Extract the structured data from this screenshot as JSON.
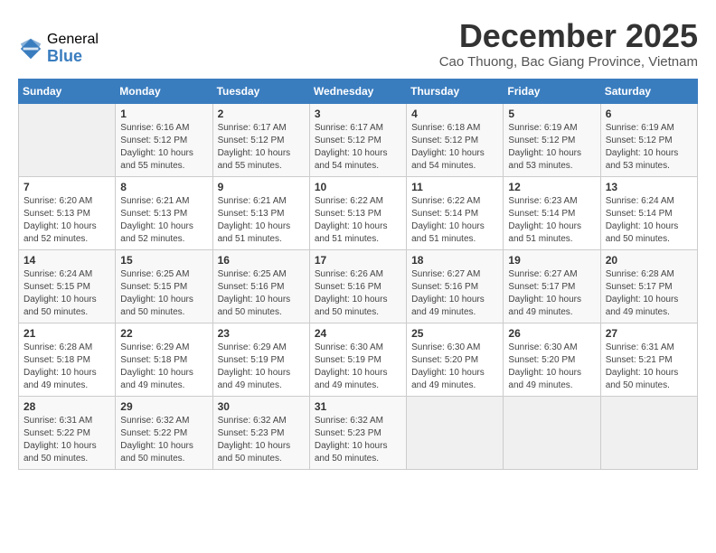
{
  "logo": {
    "general": "General",
    "blue": "Blue"
  },
  "header": {
    "month": "December 2025",
    "location": "Cao Thuong, Bac Giang Province, Vietnam"
  },
  "weekdays": [
    "Sunday",
    "Monday",
    "Tuesday",
    "Wednesday",
    "Thursday",
    "Friday",
    "Saturday"
  ],
  "weeks": [
    [
      {
        "day": "",
        "sunrise": "",
        "sunset": "",
        "daylight": ""
      },
      {
        "day": "1",
        "sunrise": "Sunrise: 6:16 AM",
        "sunset": "Sunset: 5:12 PM",
        "daylight": "Daylight: 10 hours and 55 minutes."
      },
      {
        "day": "2",
        "sunrise": "Sunrise: 6:17 AM",
        "sunset": "Sunset: 5:12 PM",
        "daylight": "Daylight: 10 hours and 55 minutes."
      },
      {
        "day": "3",
        "sunrise": "Sunrise: 6:17 AM",
        "sunset": "Sunset: 5:12 PM",
        "daylight": "Daylight: 10 hours and 54 minutes."
      },
      {
        "day": "4",
        "sunrise": "Sunrise: 6:18 AM",
        "sunset": "Sunset: 5:12 PM",
        "daylight": "Daylight: 10 hours and 54 minutes."
      },
      {
        "day": "5",
        "sunrise": "Sunrise: 6:19 AM",
        "sunset": "Sunset: 5:12 PM",
        "daylight": "Daylight: 10 hours and 53 minutes."
      },
      {
        "day": "6",
        "sunrise": "Sunrise: 6:19 AM",
        "sunset": "Sunset: 5:12 PM",
        "daylight": "Daylight: 10 hours and 53 minutes."
      }
    ],
    [
      {
        "day": "7",
        "sunrise": "Sunrise: 6:20 AM",
        "sunset": "Sunset: 5:13 PM",
        "daylight": "Daylight: 10 hours and 52 minutes."
      },
      {
        "day": "8",
        "sunrise": "Sunrise: 6:21 AM",
        "sunset": "Sunset: 5:13 PM",
        "daylight": "Daylight: 10 hours and 52 minutes."
      },
      {
        "day": "9",
        "sunrise": "Sunrise: 6:21 AM",
        "sunset": "Sunset: 5:13 PM",
        "daylight": "Daylight: 10 hours and 51 minutes."
      },
      {
        "day": "10",
        "sunrise": "Sunrise: 6:22 AM",
        "sunset": "Sunset: 5:13 PM",
        "daylight": "Daylight: 10 hours and 51 minutes."
      },
      {
        "day": "11",
        "sunrise": "Sunrise: 6:22 AM",
        "sunset": "Sunset: 5:14 PM",
        "daylight": "Daylight: 10 hours and 51 minutes."
      },
      {
        "day": "12",
        "sunrise": "Sunrise: 6:23 AM",
        "sunset": "Sunset: 5:14 PM",
        "daylight": "Daylight: 10 hours and 51 minutes."
      },
      {
        "day": "13",
        "sunrise": "Sunrise: 6:24 AM",
        "sunset": "Sunset: 5:14 PM",
        "daylight": "Daylight: 10 hours and 50 minutes."
      }
    ],
    [
      {
        "day": "14",
        "sunrise": "Sunrise: 6:24 AM",
        "sunset": "Sunset: 5:15 PM",
        "daylight": "Daylight: 10 hours and 50 minutes."
      },
      {
        "day": "15",
        "sunrise": "Sunrise: 6:25 AM",
        "sunset": "Sunset: 5:15 PM",
        "daylight": "Daylight: 10 hours and 50 minutes."
      },
      {
        "day": "16",
        "sunrise": "Sunrise: 6:25 AM",
        "sunset": "Sunset: 5:16 PM",
        "daylight": "Daylight: 10 hours and 50 minutes."
      },
      {
        "day": "17",
        "sunrise": "Sunrise: 6:26 AM",
        "sunset": "Sunset: 5:16 PM",
        "daylight": "Daylight: 10 hours and 50 minutes."
      },
      {
        "day": "18",
        "sunrise": "Sunrise: 6:27 AM",
        "sunset": "Sunset: 5:16 PM",
        "daylight": "Daylight: 10 hours and 49 minutes."
      },
      {
        "day": "19",
        "sunrise": "Sunrise: 6:27 AM",
        "sunset": "Sunset: 5:17 PM",
        "daylight": "Daylight: 10 hours and 49 minutes."
      },
      {
        "day": "20",
        "sunrise": "Sunrise: 6:28 AM",
        "sunset": "Sunset: 5:17 PM",
        "daylight": "Daylight: 10 hours and 49 minutes."
      }
    ],
    [
      {
        "day": "21",
        "sunrise": "Sunrise: 6:28 AM",
        "sunset": "Sunset: 5:18 PM",
        "daylight": "Daylight: 10 hours and 49 minutes."
      },
      {
        "day": "22",
        "sunrise": "Sunrise: 6:29 AM",
        "sunset": "Sunset: 5:18 PM",
        "daylight": "Daylight: 10 hours and 49 minutes."
      },
      {
        "day": "23",
        "sunrise": "Sunrise: 6:29 AM",
        "sunset": "Sunset: 5:19 PM",
        "daylight": "Daylight: 10 hours and 49 minutes."
      },
      {
        "day": "24",
        "sunrise": "Sunrise: 6:30 AM",
        "sunset": "Sunset: 5:19 PM",
        "daylight": "Daylight: 10 hours and 49 minutes."
      },
      {
        "day": "25",
        "sunrise": "Sunrise: 6:30 AM",
        "sunset": "Sunset: 5:20 PM",
        "daylight": "Daylight: 10 hours and 49 minutes."
      },
      {
        "day": "26",
        "sunrise": "Sunrise: 6:30 AM",
        "sunset": "Sunset: 5:20 PM",
        "daylight": "Daylight: 10 hours and 49 minutes."
      },
      {
        "day": "27",
        "sunrise": "Sunrise: 6:31 AM",
        "sunset": "Sunset: 5:21 PM",
        "daylight": "Daylight: 10 hours and 50 minutes."
      }
    ],
    [
      {
        "day": "28",
        "sunrise": "Sunrise: 6:31 AM",
        "sunset": "Sunset: 5:22 PM",
        "daylight": "Daylight: 10 hours and 50 minutes."
      },
      {
        "day": "29",
        "sunrise": "Sunrise: 6:32 AM",
        "sunset": "Sunset: 5:22 PM",
        "daylight": "Daylight: 10 hours and 50 minutes."
      },
      {
        "day": "30",
        "sunrise": "Sunrise: 6:32 AM",
        "sunset": "Sunset: 5:23 PM",
        "daylight": "Daylight: 10 hours and 50 minutes."
      },
      {
        "day": "31",
        "sunrise": "Sunrise: 6:32 AM",
        "sunset": "Sunset: 5:23 PM",
        "daylight": "Daylight: 10 hours and 50 minutes."
      },
      {
        "day": "",
        "sunrise": "",
        "sunset": "",
        "daylight": ""
      },
      {
        "day": "",
        "sunrise": "",
        "sunset": "",
        "daylight": ""
      },
      {
        "day": "",
        "sunrise": "",
        "sunset": "",
        "daylight": ""
      }
    ]
  ]
}
